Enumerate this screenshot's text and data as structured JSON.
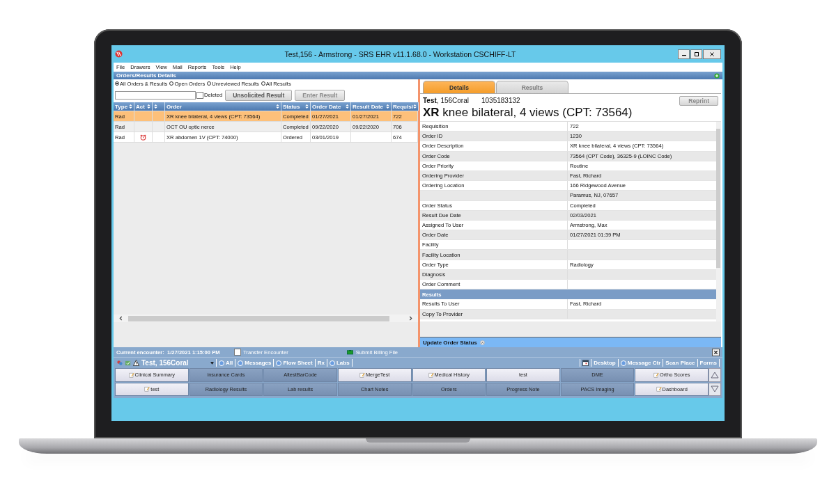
{
  "window": {
    "title": "Test,156 - Armstrong - SRS EHR v11.1.68.0 - Workstation CSCHIFF-LT"
  },
  "menu": [
    "File",
    "Drawers",
    "View",
    "Mail",
    "Reports",
    "Tools",
    "Help"
  ],
  "panel_title": "Orders/Results Details",
  "filters": [
    {
      "label": "All Orders & Results",
      "selected": true
    },
    {
      "label": "Open Orders",
      "selected": false
    },
    {
      "label": "Unreviewed Results",
      "selected": false
    },
    {
      "label": "All Results",
      "selected": false
    }
  ],
  "deleted": {
    "label": "Deleted",
    "checked": false
  },
  "buttons": [
    {
      "label": "Unsolicited Result",
      "disabled": false
    },
    {
      "label": "Enter Result",
      "disabled": true
    }
  ],
  "table": {
    "columns": [
      "Type",
      "Act",
      null,
      "Order",
      "Status",
      "Order Date",
      "Result Date",
      "Requisi"
    ],
    "rows": [
      {
        "type": "Rad",
        "alert": false,
        "order": "XR knee bilateral, 4 views (CPT: 73564)",
        "status": "Completed",
        "order_date": "01/27/2021",
        "result_date": "01/27/2021",
        "requisition": "722",
        "selected": true
      },
      {
        "type": "Rad",
        "alert": false,
        "order": "OCT OU optic nerce",
        "status": "Completed",
        "order_date": "09/22/2020",
        "result_date": "09/22/2020",
        "requisition": "706",
        "selected": false
      },
      {
        "type": "Rad",
        "alert": true,
        "order": "XR abdomen 1V (CPT: 74000)",
        "status": "Ordered",
        "order_date": "03/01/2019",
        "requisition": "674",
        "selected": false
      }
    ]
  },
  "detail_tabs": [
    {
      "label": "Details",
      "selected": true
    },
    {
      "label": "Results",
      "selected": false
    }
  ],
  "patient": {
    "last": "Test",
    "first": ", 156Coral",
    "id": "1035183132"
  },
  "reprint": {
    "label": "Reprint",
    "disabled": true
  },
  "order_title": "**XR** knee bilateral, 4 views (CPT: 73564)",
  "details": [
    {
      "kind": "field",
      "label": "Requisition",
      "value": "722"
    },
    {
      "kind": "field",
      "label": "Order ID",
      "value": "1230"
    },
    {
      "kind": "field",
      "label": "Order Description",
      "value": "XR knee bilateral, 4 views (CPT: 73564)"
    },
    {
      "kind": "field",
      "label": "Order Code",
      "value": "73564 (CPT Code), 36325-9 (LOINC Code)"
    },
    {
      "kind": "field",
      "label": "Order Priority",
      "value": "Routine"
    },
    {
      "kind": "field",
      "label": "Ordering Provider",
      "value": "Fast, Richard"
    },
    {
      "kind": "field",
      "label": "Ordering Location",
      "value": "166 Ridgewood Avenue"
    },
    {
      "kind": "field",
      "value": "Paramus, NJ, 07657"
    },
    {
      "kind": "field",
      "label": "Order Status",
      "value": "Completed"
    },
    {
      "kind": "field",
      "label": "Result Due Date",
      "value": "02/03/2021"
    },
    {
      "kind": "field",
      "label": "Assigned To User",
      "value": "Armstrong, Max"
    },
    {
      "kind": "field",
      "label": "Order Date",
      "value": "01/27/2021 01:39 PM"
    },
    {
      "kind": "field",
      "label": "Facility"
    },
    {
      "kind": "field",
      "label": "Facility Location"
    },
    {
      "kind": "field",
      "label": "Order Type",
      "value": "Radiology"
    },
    {
      "kind": "field",
      "label": "Diagnosis"
    },
    {
      "kind": "field",
      "label": "Order Comment"
    },
    {
      "kind": "section",
      "label": "Results"
    },
    {
      "kind": "field",
      "label": "Results To User",
      "value": "Fast, Richard"
    },
    {
      "kind": "field",
      "label": "Copy To Provider"
    }
  ],
  "update_status": "Update Order Status",
  "encounter": {
    "label": "Current encounter:",
    "value": "1/27/2021 1:15:00 PM",
    "transfer": "Transfer Encounter",
    "transfer_checked": false,
    "billing": "Submit Billing File"
  },
  "patient_bar": {
    "name": "Test, 156Coral",
    "left_links": [
      "All",
      "Messages",
      "Flow Sheet",
      "Rx",
      "Labs"
    ],
    "right_links": [
      "Desktop",
      "Message Ctr",
      "Scan Place",
      "Forms"
    ]
  },
  "drawer_tabs": [
    {
      "label": "Clinical Summary",
      "kind": "pinned"
    },
    {
      "label": "insurance Cards",
      "kind": "plain"
    },
    {
      "label": "AltestBarCode",
      "kind": "plain"
    },
    {
      "label": "MergeTest",
      "kind": "pinned"
    },
    {
      "label": "Medical History",
      "kind": "pinned"
    },
    {
      "label": "test",
      "kind": "light"
    },
    {
      "label": "DME",
      "kind": "plain"
    },
    {
      "label": "Ortho Scores",
      "kind": "pinned"
    },
    {
      "label": "test",
      "kind": "pinned"
    },
    {
      "label": "Radiology Results",
      "kind": "plain"
    },
    {
      "label": "Lab results",
      "kind": "plain"
    },
    {
      "label": "Chart Notes",
      "kind": "plain"
    },
    {
      "label": "Orders",
      "kind": "plain"
    },
    {
      "label": "Progress Note",
      "kind": "plain"
    },
    {
      "label": "PACS Imaging",
      "kind": "plain"
    },
    {
      "label": "Dashboard",
      "kind": "pinned"
    }
  ]
}
